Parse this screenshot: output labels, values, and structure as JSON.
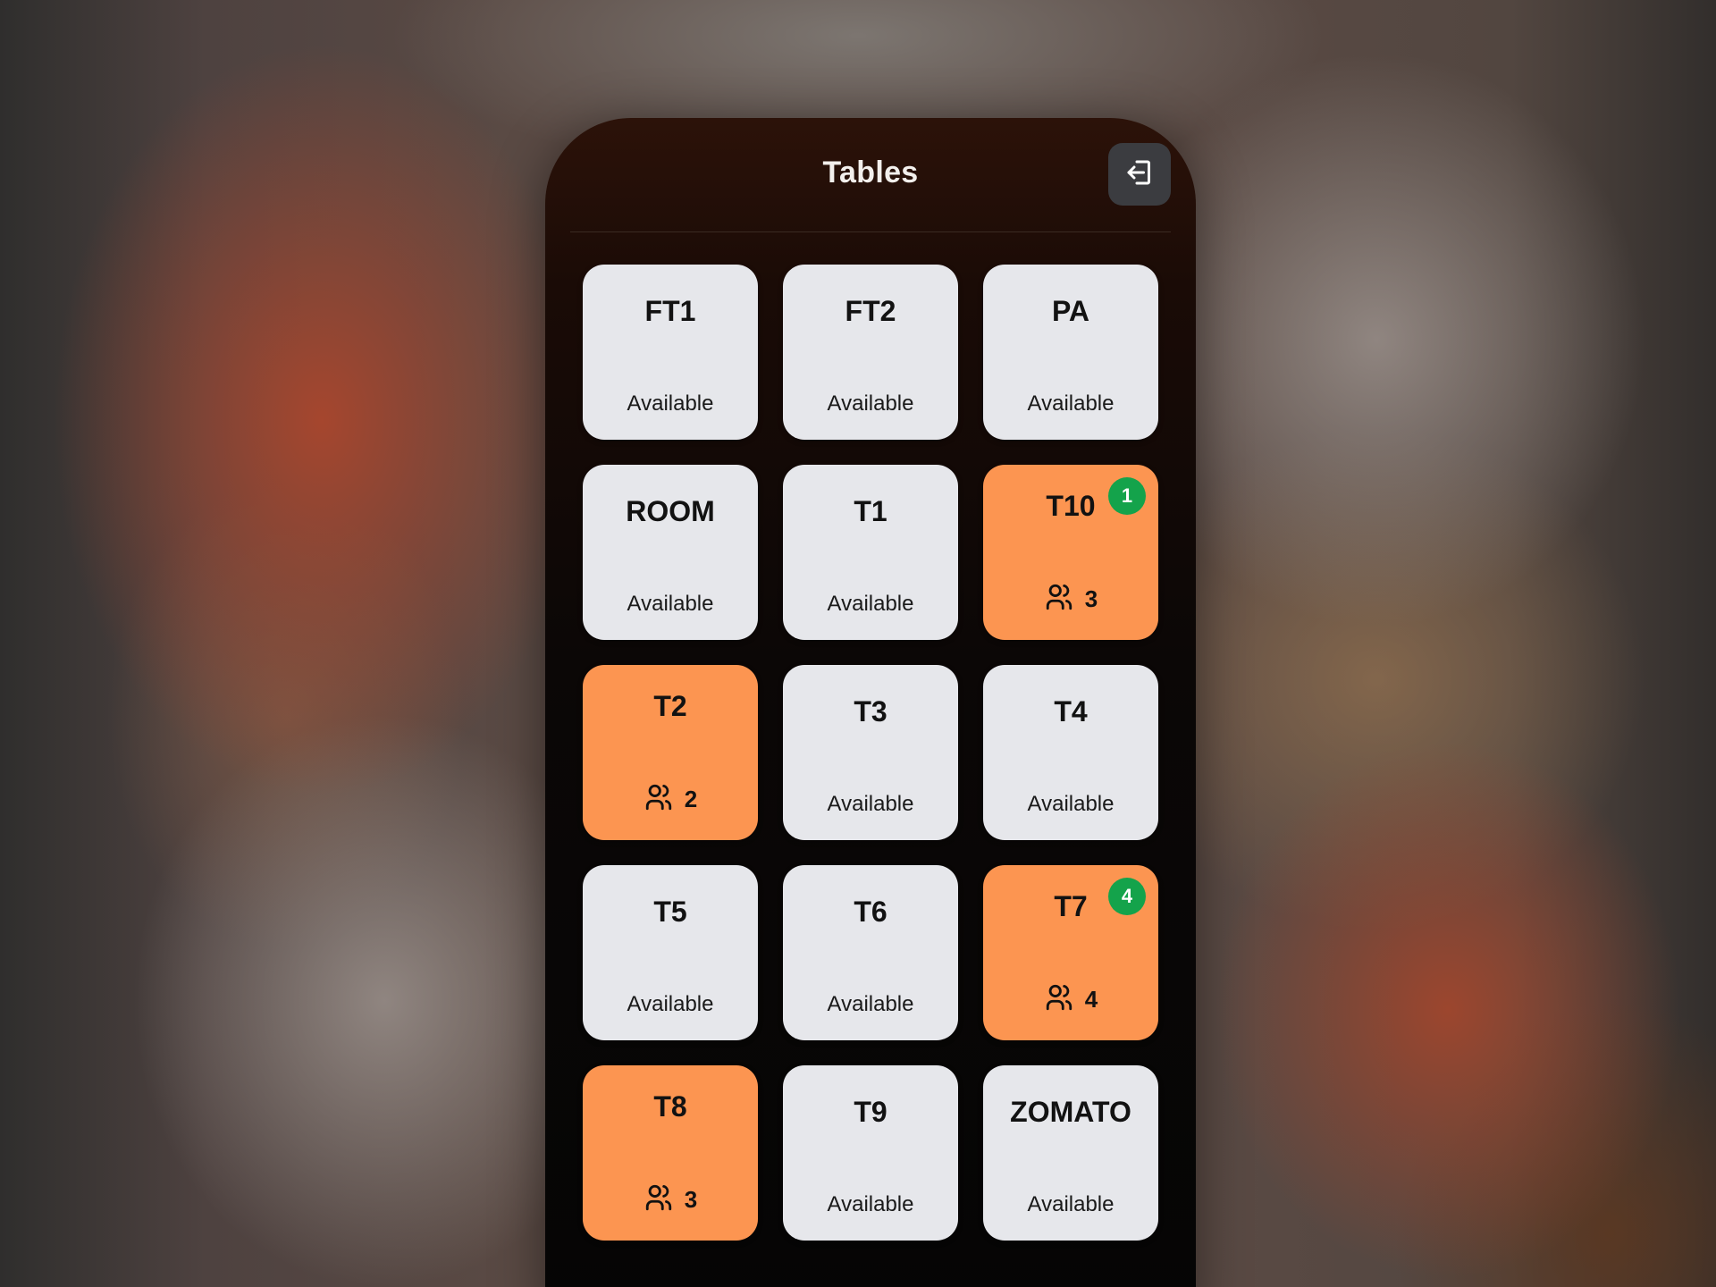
{
  "header": {
    "title": "Tables",
    "logout_icon": "logout-icon"
  },
  "colors": {
    "available_tile": "#e6e7eb",
    "occupied_tile": "#fc9551",
    "badge": "#14a34b",
    "logout_button": "#3b3c40"
  },
  "tables": [
    {
      "name": "FT1",
      "status": "Available"
    },
    {
      "name": "FT2",
      "status": "Available"
    },
    {
      "name": "PA",
      "status": "Available"
    },
    {
      "name": "ROOM",
      "status": "Available"
    },
    {
      "name": "T1",
      "status": "Available"
    },
    {
      "name": "T10",
      "guests": "3",
      "badge": "1",
      "guest_icon": "users-icon"
    },
    {
      "name": "T2",
      "guests": "2",
      "guest_icon": "users-icon"
    },
    {
      "name": "T3",
      "status": "Available"
    },
    {
      "name": "T4",
      "status": "Available"
    },
    {
      "name": "T5",
      "status": "Available"
    },
    {
      "name": "T6",
      "status": "Available"
    },
    {
      "name": "T7",
      "guests": "4",
      "badge": "4",
      "guest_icon": "users-icon"
    },
    {
      "name": "T8",
      "guests": "3",
      "guest_icon": "users-icon"
    },
    {
      "name": "T9",
      "status": "Available"
    },
    {
      "name": "ZOMATO",
      "status": "Available"
    }
  ]
}
